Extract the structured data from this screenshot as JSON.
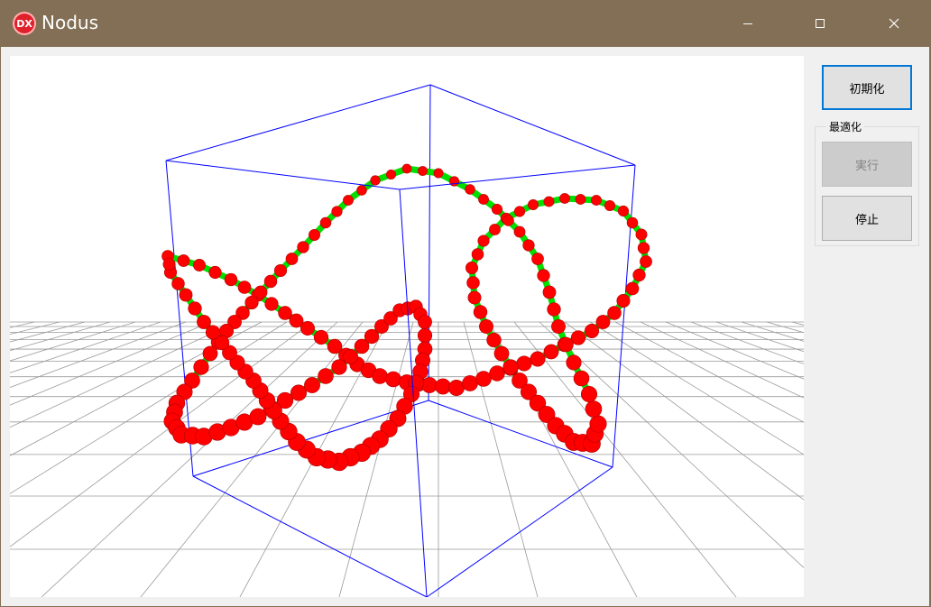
{
  "window": {
    "title": "Nodus",
    "icon_text": "DX",
    "title_bar_color": "#836f55"
  },
  "controls": {
    "minimize": "minimize-icon",
    "maximize": "maximize-icon",
    "close": "close-icon"
  },
  "sidebar": {
    "init_button": "初期化",
    "group_label": "最適化",
    "run_button": "実行",
    "stop_button": "停止"
  },
  "scene": {
    "box_color": "#0000ff",
    "node_color": "#ff0000",
    "link_color": "#00e000",
    "grid_color": "#9a9a9a"
  }
}
